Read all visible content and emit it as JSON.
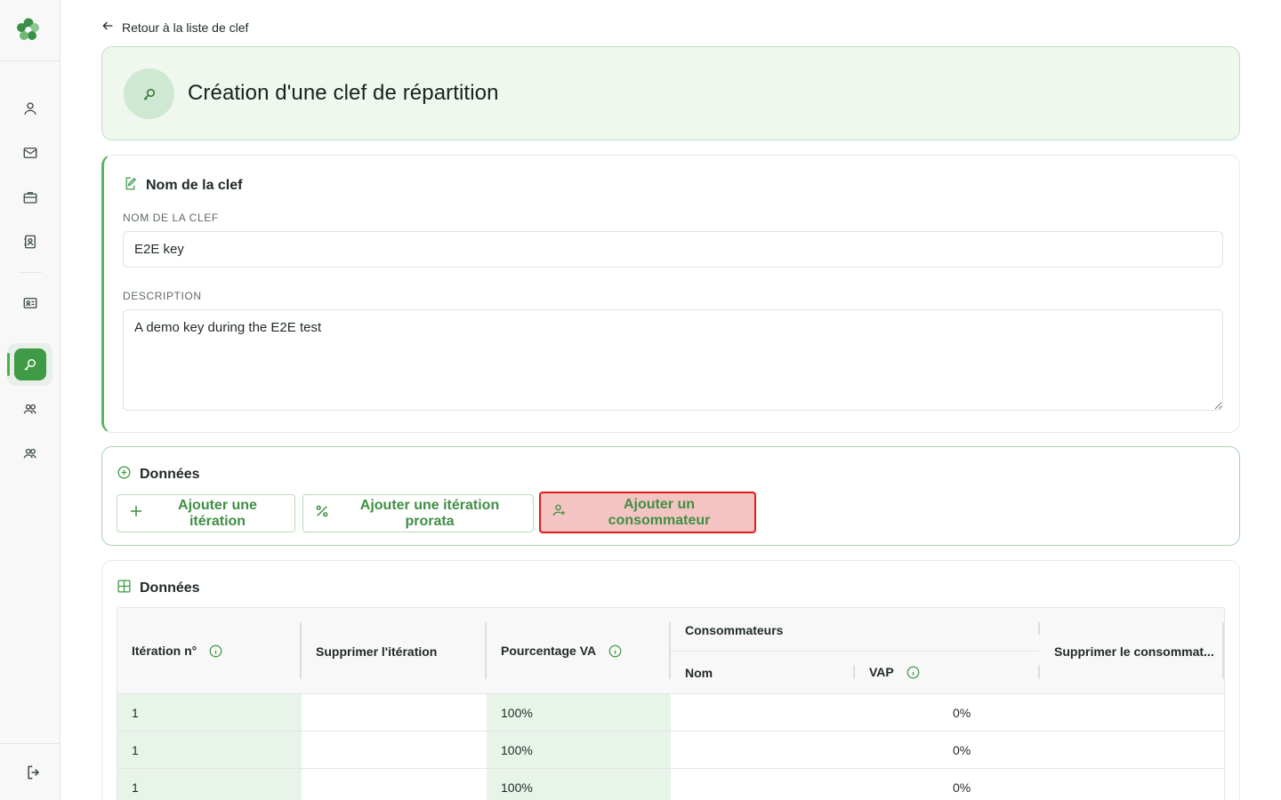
{
  "back_link": {
    "label": "Retour à la liste de clef"
  },
  "page": {
    "title": "Création d'une clef de répartition"
  },
  "name_card": {
    "heading": "Nom de la clef",
    "name_label": "NOM DE LA CLEF",
    "name_value": "E2E key",
    "description_label": "DESCRIPTION",
    "description_value": "A demo key during the E2E test"
  },
  "actions_card": {
    "heading": "Données",
    "buttons": {
      "add_iteration": "Ajouter une itération",
      "add_prorata_iteration": "Ajouter une itération prorata",
      "add_consumer": "Ajouter un consommateur"
    }
  },
  "table_card": {
    "heading": "Données",
    "columns": {
      "iteration": "Itération n°",
      "delete_iteration": "Supprimer l'itération",
      "percentage": "Pourcentage VA",
      "consumers": "Consommateurs",
      "name": "Nom",
      "vap": "VAP",
      "delete_consumer": "Supprimer le consommat..."
    },
    "rows": [
      {
        "iteration": "1",
        "percentage": "100%",
        "vap": "0%"
      },
      {
        "iteration": "1",
        "percentage": "100%",
        "vap": "0%"
      },
      {
        "iteration": "1",
        "percentage": "100%",
        "vap": "0%"
      }
    ]
  },
  "colors": {
    "accent_green": "#3f9a45",
    "highlight_border": "#e01b1b",
    "highlight_fill": "#f4c4c2"
  }
}
